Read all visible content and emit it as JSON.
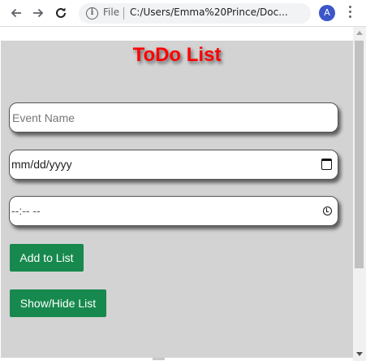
{
  "browser": {
    "scheme_label": "File",
    "url": "C:/Users/Emma%20Prince/Doc...",
    "avatar_letter": "A",
    "avatar_color": "#3c56c9"
  },
  "page": {
    "title": "ToDo List",
    "title_color": "#ff0000",
    "background_color": "#d3d3d3",
    "event_name_placeholder": "Event Name",
    "date_placeholder": "mm/dd/yyyy",
    "time_placeholder": "--:-- --",
    "add_button_label": "Add to List",
    "toggle_button_label": "Show/Hide List",
    "button_color": "#17894e"
  }
}
